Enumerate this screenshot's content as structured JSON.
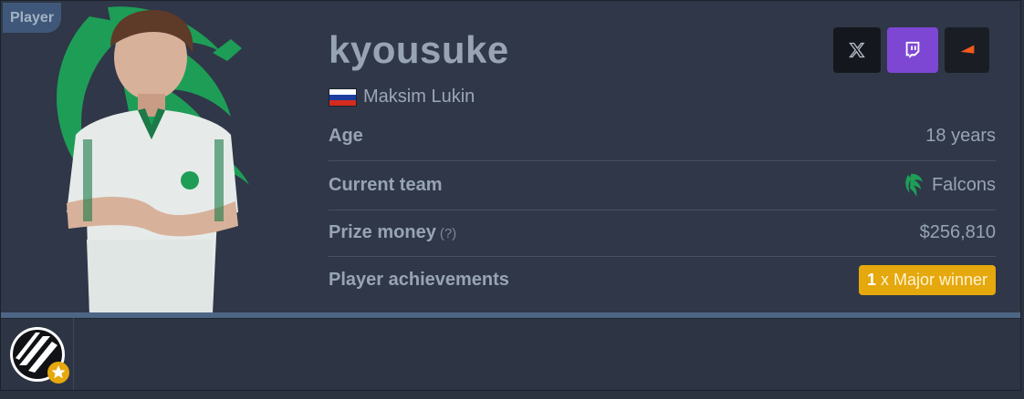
{
  "tag": "Player",
  "player": {
    "nickname": "kyousuke",
    "real_name": "Maksim Lukin",
    "country_flag": [
      "#ffffff",
      "#1c3ea0",
      "#d52b1e"
    ]
  },
  "social": {
    "x_icon": "x-logo-icon",
    "twitch_icon": "twitch-logo-icon",
    "faceit_icon": "faceit-logo-icon"
  },
  "rows": [
    {
      "label": "Age",
      "value": "18 years"
    },
    {
      "label": "Current team",
      "value": "Falcons"
    },
    {
      "label": "Prize money",
      "hint": "(?)",
      "value": "$256,810"
    },
    {
      "label": "Player achievements",
      "count": "1",
      "value": " x Major winner"
    }
  ],
  "colors": {
    "accent_green": "#1e9d57",
    "achievement_gold": "#e5a80d",
    "twitch_purple": "#7d47d4",
    "faceit_orange": "#f25a1c"
  }
}
